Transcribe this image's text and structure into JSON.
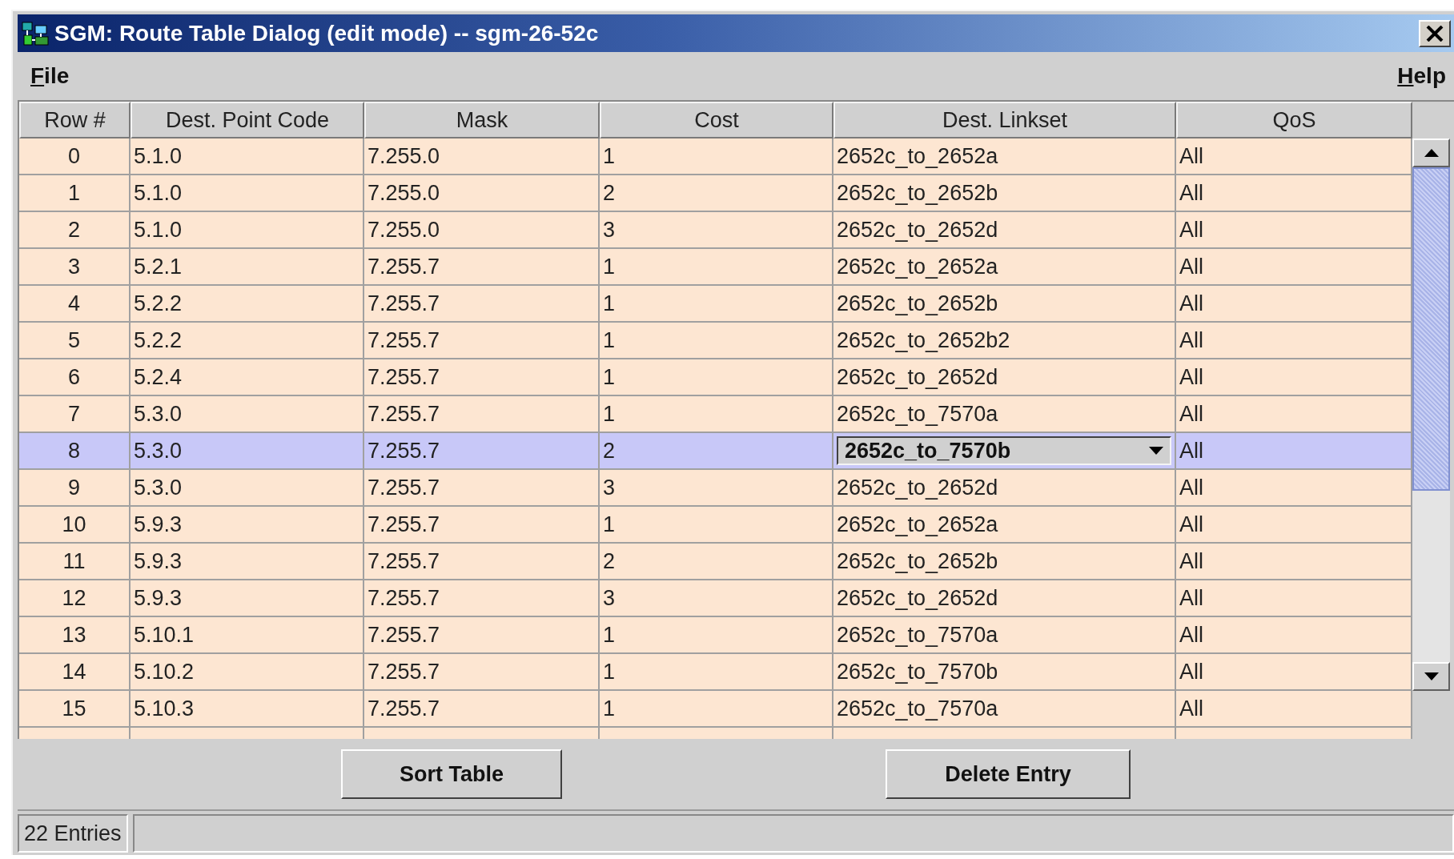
{
  "window": {
    "title": "SGM: Route Table Dialog (edit mode) -- sgm-26-52c"
  },
  "menu": [
    "File",
    "Help"
  ],
  "table": {
    "columns": [
      "Row #",
      "Dest. Point Code",
      "Mask",
      "Cost",
      "Dest. Linkset",
      "QoS"
    ],
    "rows": [
      {
        "cells": [
          "0",
          "5.1.0",
          "7.255.0",
          "1",
          "2652c_to_2652a",
          "All"
        ],
        "selected": false,
        "editing": false
      },
      {
        "cells": [
          "1",
          "5.1.0",
          "7.255.0",
          "2",
          "2652c_to_2652b",
          "All"
        ],
        "selected": false,
        "editing": false
      },
      {
        "cells": [
          "2",
          "5.1.0",
          "7.255.0",
          "3",
          "2652c_to_2652d",
          "All"
        ],
        "selected": false,
        "editing": false
      },
      {
        "cells": [
          "3",
          "5.2.1",
          "7.255.7",
          "1",
          "2652c_to_2652a",
          "All"
        ],
        "selected": false,
        "editing": false
      },
      {
        "cells": [
          "4",
          "5.2.2",
          "7.255.7",
          "1",
          "2652c_to_2652b",
          "All"
        ],
        "selected": false,
        "editing": false
      },
      {
        "cells": [
          "5",
          "5.2.2",
          "7.255.7",
          "1",
          "2652c_to_2652b2",
          "All"
        ],
        "selected": false,
        "editing": false
      },
      {
        "cells": [
          "6",
          "5.2.4",
          "7.255.7",
          "1",
          "2652c_to_2652d",
          "All"
        ],
        "selected": false,
        "editing": false
      },
      {
        "cells": [
          "7",
          "5.3.0",
          "7.255.7",
          "1",
          "2652c_to_7570a",
          "All"
        ],
        "selected": false,
        "editing": false
      },
      {
        "cells": [
          "8",
          "5.3.0",
          "7.255.7",
          "2",
          "2652c_to_7570b",
          "All"
        ],
        "selected": true,
        "editing": true
      },
      {
        "cells": [
          "9",
          "5.3.0",
          "7.255.7",
          "3",
          "2652c_to_2652d",
          "All"
        ],
        "selected": false,
        "editing": false
      },
      {
        "cells": [
          "10",
          "5.9.3",
          "7.255.7",
          "1",
          "2652c_to_2652a",
          "All"
        ],
        "selected": false,
        "editing": false
      },
      {
        "cells": [
          "11",
          "5.9.3",
          "7.255.7",
          "2",
          "2652c_to_2652b",
          "All"
        ],
        "selected": false,
        "editing": false
      },
      {
        "cells": [
          "12",
          "5.9.3",
          "7.255.7",
          "3",
          "2652c_to_2652d",
          "All"
        ],
        "selected": false,
        "editing": false
      },
      {
        "cells": [
          "13",
          "5.10.1",
          "7.255.7",
          "1",
          "2652c_to_7570a",
          "All"
        ],
        "selected": false,
        "editing": false
      },
      {
        "cells": [
          "14",
          "5.10.2",
          "7.255.7",
          "1",
          "2652c_to_7570b",
          "All"
        ],
        "selected": false,
        "editing": false
      },
      {
        "cells": [
          "15",
          "5.10.3",
          "7.255.7",
          "1",
          "2652c_to_7570a",
          "All"
        ],
        "selected": false,
        "editing": false
      }
    ]
  },
  "buttons": [
    "Sort Table",
    "Delete Entry"
  ],
  "status_bar": {
    "text": "22 Entries"
  }
}
